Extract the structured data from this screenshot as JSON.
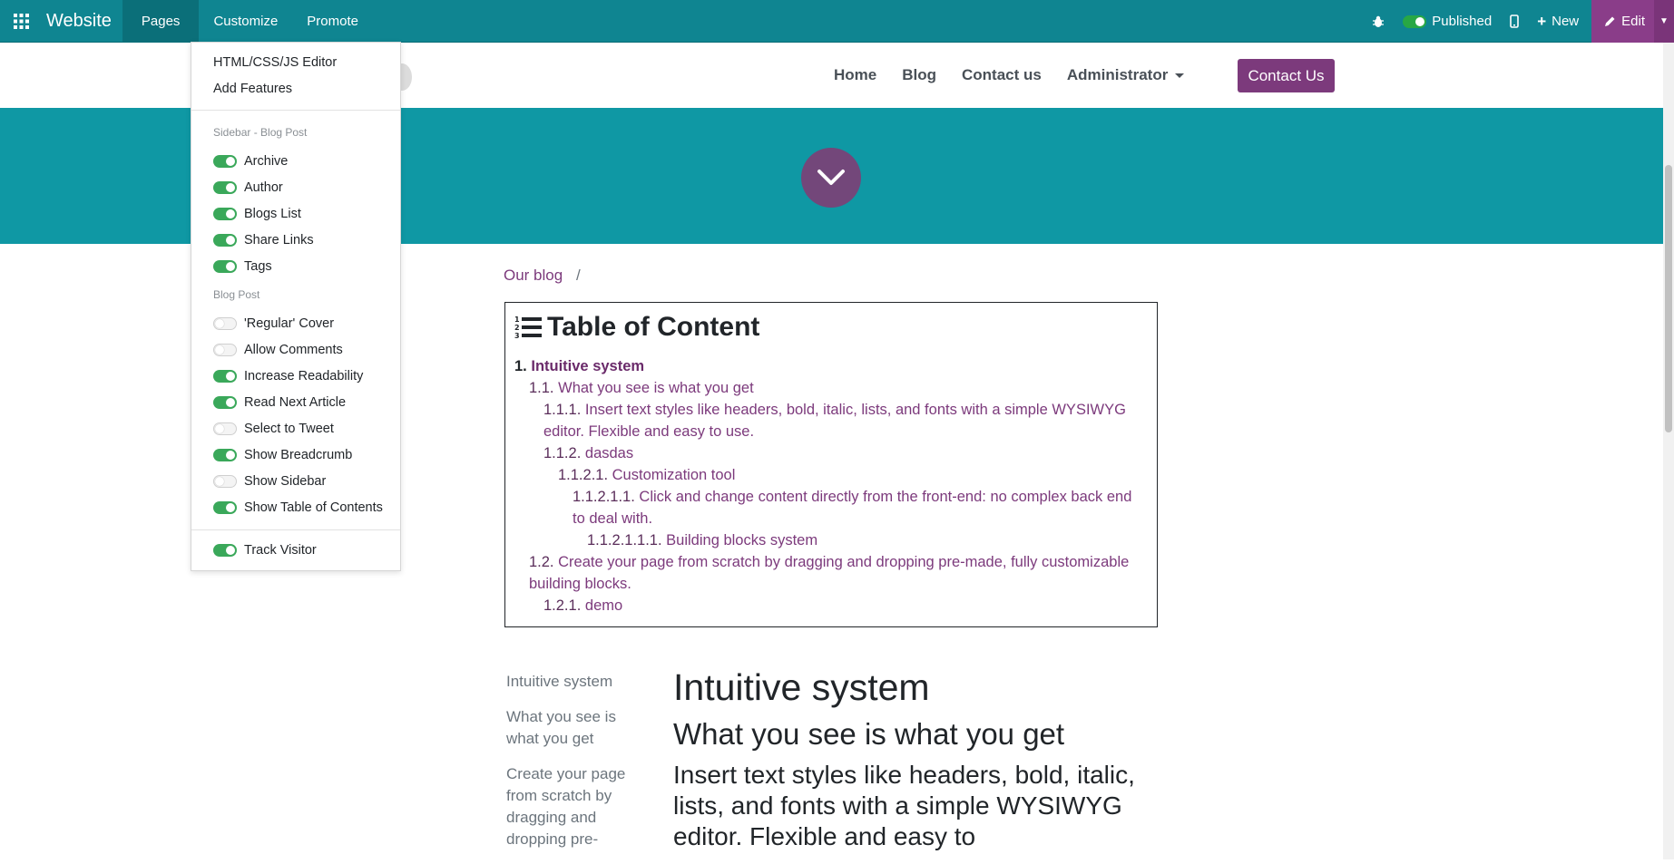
{
  "topbar": {
    "brand": "Website",
    "menus": [
      "Pages",
      "Customize",
      "Promote"
    ],
    "published_label": "Published",
    "new_label": "New",
    "edit_label": "Edit"
  },
  "header": {
    "nav": [
      "Home",
      "Blog",
      "Contact us",
      "Administrator"
    ],
    "contact_button": "Contact Us"
  },
  "breadcrumb": {
    "item": "Our blog",
    "separator": "/"
  },
  "toc": {
    "title": "Table of Content",
    "entries": [
      {
        "num": "1.",
        "text": "Intuitive system"
      },
      {
        "num": "1.1.",
        "text": "What you see is what you get"
      },
      {
        "num": "1.1.1.",
        "text": "Insert text styles like headers, bold, italic, lists, and fonts with a simple WYSIWYG editor. Flexible and easy to use."
      },
      {
        "num": "1.1.2.",
        "text": "dasdas"
      },
      {
        "num": "1.1.2.1.",
        "text": "Customization tool"
      },
      {
        "num": "1.1.2.1.1.",
        "text": "Click and change content directly from the front-end: no complex back end to deal with."
      },
      {
        "num": "1.1.2.1.1.1.",
        "text": "Building blocks system"
      },
      {
        "num": "1.2.",
        "text": "Create your page from scratch by dragging and dropping pre-made, fully customizable building blocks."
      },
      {
        "num": "1.2.1.",
        "text": "demo"
      }
    ]
  },
  "sidetoc": [
    "Intuitive system",
    "What you see is what you get",
    "Create your page from scratch by dragging and dropping pre-"
  ],
  "content": {
    "h1": "Intuitive system",
    "h2": "What you see is what you get",
    "para": "Insert text styles like headers, bold, italic, lists, and fonts with a simple WYSIWYG editor. Flexible and easy to"
  },
  "dropdown": {
    "links": [
      "HTML/CSS/JS Editor",
      "Add Features"
    ],
    "section1": "Sidebar - Blog Post",
    "sidebar_options": [
      {
        "label": "Archive",
        "on": true
      },
      {
        "label": "Author",
        "on": true
      },
      {
        "label": "Blogs List",
        "on": true
      },
      {
        "label": "Share Links",
        "on": true
      },
      {
        "label": "Tags",
        "on": true
      }
    ],
    "section2": "Blog Post",
    "post_options": [
      {
        "label": "'Regular' Cover",
        "on": false
      },
      {
        "label": "Allow Comments",
        "on": false
      },
      {
        "label": "Increase Readability",
        "on": true
      },
      {
        "label": "Read Next Article",
        "on": true
      },
      {
        "label": "Select to Tweet",
        "on": false
      },
      {
        "label": "Show Breadcrumb",
        "on": true
      },
      {
        "label": "Show Sidebar",
        "on": false
      },
      {
        "label": "Show Table of Contents",
        "on": true
      }
    ],
    "track_option": {
      "label": "Track Visitor",
      "on": true
    }
  },
  "colors": {
    "topbar": "#0f8591",
    "banner": "#0f98a4",
    "accent_purple": "#7c3a7c",
    "toggle_on": "#3aa85a"
  },
  "icons": [
    "apps-grid-icon",
    "bug-icon",
    "mobile-icon",
    "plus-icon",
    "pencil-icon",
    "chevron-down-icon",
    "toc-list-icon"
  ]
}
